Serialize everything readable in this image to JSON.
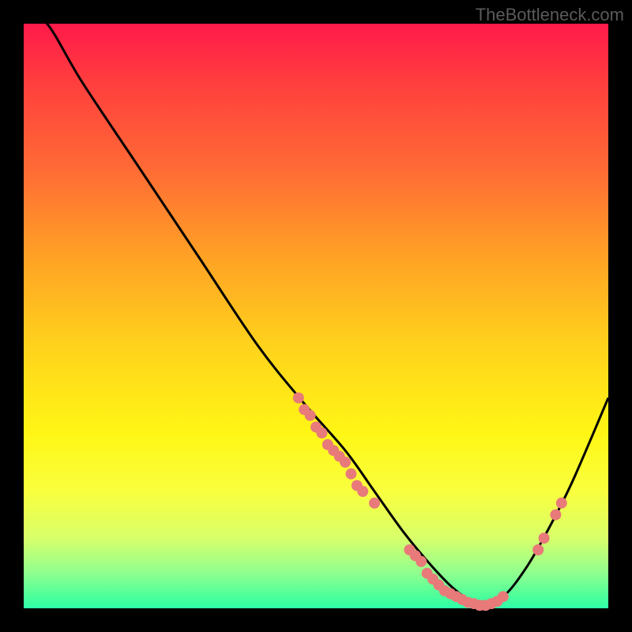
{
  "watermark": "TheBottleneck.com",
  "chart_data": {
    "type": "line",
    "title": "",
    "xlabel": "",
    "ylabel": "",
    "xlim": [
      0,
      100
    ],
    "ylim": [
      0,
      100
    ],
    "background": "red-yellow-green vertical gradient",
    "curve": {
      "description": "Bottleneck curve: steep descent from top-left, reaches minimum near x≈78, rises toward right edge",
      "x": [
        0,
        4,
        10,
        20,
        30,
        40,
        48,
        55,
        60,
        65,
        70,
        74,
        78,
        82,
        86,
        90,
        94,
        100
      ],
      "y": [
        102,
        100,
        90,
        75,
        60,
        45,
        35,
        27,
        20,
        13,
        7,
        3,
        0.5,
        2,
        7,
        14,
        22,
        36
      ]
    },
    "points": {
      "description": "Salmon-colored data points scattered along the curve, concentrated in the trough",
      "coords": [
        [
          47,
          36
        ],
        [
          48,
          34
        ],
        [
          49,
          33
        ],
        [
          50,
          31
        ],
        [
          51,
          30
        ],
        [
          52,
          28
        ],
        [
          53,
          27
        ],
        [
          54,
          26
        ],
        [
          55,
          25
        ],
        [
          56,
          23
        ],
        [
          57,
          21
        ],
        [
          58,
          20
        ],
        [
          60,
          18
        ],
        [
          66,
          10
        ],
        [
          67,
          9
        ],
        [
          68,
          8
        ],
        [
          69,
          6
        ],
        [
          70,
          5
        ],
        [
          71,
          4
        ],
        [
          72,
          3
        ],
        [
          73,
          2.5
        ],
        [
          74,
          2
        ],
        [
          75,
          1.5
        ],
        [
          76,
          1
        ],
        [
          77,
          0.8
        ],
        [
          78,
          0.5
        ],
        [
          79,
          0.5
        ],
        [
          80,
          0.8
        ],
        [
          81,
          1.2
        ],
        [
          82,
          2
        ],
        [
          88,
          10
        ],
        [
          89,
          12
        ],
        [
          91,
          16
        ],
        [
          92,
          18
        ]
      ]
    }
  }
}
